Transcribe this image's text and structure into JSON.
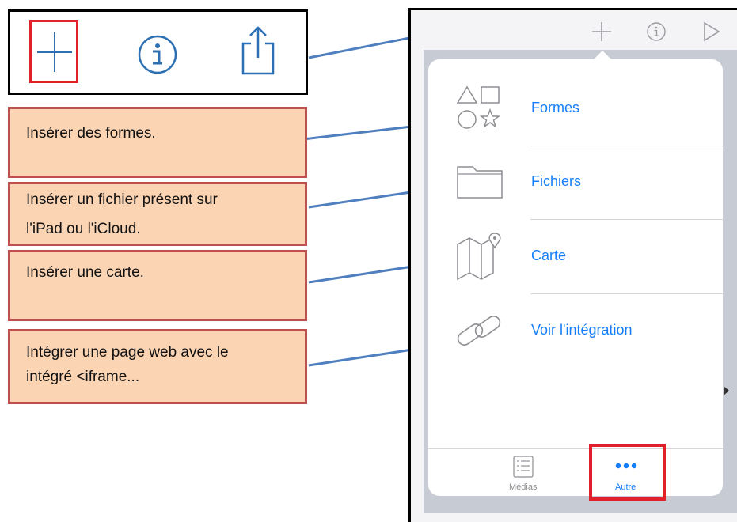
{
  "toolbar_callout": {
    "icons": [
      "plus-icon",
      "info-icon",
      "share-icon"
    ]
  },
  "callouts": {
    "formes": "Insérer des formes.",
    "fichiers_line1": "Insérer un fichier présent sur",
    "fichiers_line2": "l'iPad ou l'iCloud.",
    "carte": "Insérer une carte.",
    "embed_line1": "Intégrer une page web avec le",
    "embed_line2": "intégré <iframe..."
  },
  "ipad": {
    "topbar_icons": [
      "plus-icon",
      "info-icon",
      "play-icon"
    ],
    "menu": {
      "items": [
        {
          "label": "Formes",
          "icon": "shapes-icon"
        },
        {
          "label": "Fichiers",
          "icon": "folder-icon"
        },
        {
          "label": "Carte",
          "icon": "map-icon"
        },
        {
          "label": "Voir l'intégration",
          "icon": "link-icon"
        }
      ]
    },
    "tabs": [
      {
        "label": "Médias",
        "icon": "media-list-icon"
      },
      {
        "label": "Autre",
        "icon": "more-dots-icon"
      }
    ]
  },
  "colors": {
    "accent": "#157efb",
    "callout_fill": "#fbd4b4",
    "callout_border": "#c0504d",
    "highlight": "#e0202a",
    "arrow": "#4f7fbf"
  }
}
